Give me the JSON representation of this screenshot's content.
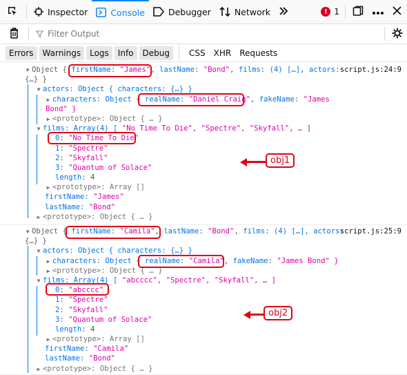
{
  "toolbar": {
    "tabs": [
      {
        "label": "Inspector",
        "icon": "inspector-icon"
      },
      {
        "label": "Console",
        "icon": "console-icon",
        "active": true
      },
      {
        "label": "Debugger",
        "icon": "debugger-icon"
      },
      {
        "label": "Network",
        "icon": "network-icon"
      }
    ],
    "error_count": "1",
    "more_tabs_icon": "double-chevron-icon",
    "dock_icon": "dock-icon",
    "menu_icon": "ellipsis-icon",
    "close_icon": "close-icon"
  },
  "filter": {
    "placeholder": "Filter Output"
  },
  "levels": [
    "Errors",
    "Warnings",
    "Logs",
    "Info",
    "Debug"
  ],
  "categories": [
    "CSS",
    "XHR",
    "Requests"
  ],
  "messages": [
    {
      "location": "script.js:24:9",
      "summary_prefix": "Object { ",
      "firstName_key": "firstName",
      "firstName_val": "\"James\"",
      "lastName_val": "\"Bond\"",
      "summary_tail": "films: (4) […], actors:",
      "summary_end": "{…} }",
      "actors_line": "actors: Object { characters: {…} }",
      "characters_prefix": "characters: Object { ",
      "realName_val": "\"Daniel Craig\"",
      "fakeName_val": "\"James",
      "fakeName_cont": "Bond\" }",
      "proto_obj": "<prototype>: Object { … }",
      "films_header_key": "films: Array(4) [ ",
      "films_header_vals": "\"No Time To Die\", \"Spectre\", \"Skyfall\", … ]",
      "films": [
        "\"No Time To Die\"",
        "\"Spectre\"",
        "\"Skyfall\"",
        "\"Quantum of Solace\""
      ],
      "length": "4",
      "proto_arr": "<prototype>: Array []",
      "firstName": "\"James\"",
      "lastName": "\"Bond\"",
      "annotation": "obj1"
    },
    {
      "location": "script.js:25:9",
      "summary_prefix": "Object { ",
      "firstName_key": "firstName",
      "firstName_val": "\"Camila\"",
      "lastName_val": "\"Bond\"",
      "summary_tail": "films: (4) […], actors:",
      "summary_end": "{…} }",
      "actors_line": "actors: Object { characters: {…} }",
      "characters_prefix": "characters: Object { ",
      "realName_val": "\"Camila\"",
      "fakeName_val": "\"James Bond\" }",
      "proto_obj": "<prototype>: Object { … }",
      "films_header_key": "films: Array(4) [ ",
      "films_header_vals": "\"abcccc\", \"Spectre\", \"Skyfall\", … ]",
      "films": [
        "\"abcccc\"",
        "\"Spectre\"",
        "\"Skyfall\"",
        "\"Quantum of Solace\""
      ],
      "length": "4",
      "proto_arr": "<prototype>: Array []",
      "firstName": "\"Camila\"",
      "lastName": "\"Bond\"",
      "annotation": "obj2"
    }
  ]
}
